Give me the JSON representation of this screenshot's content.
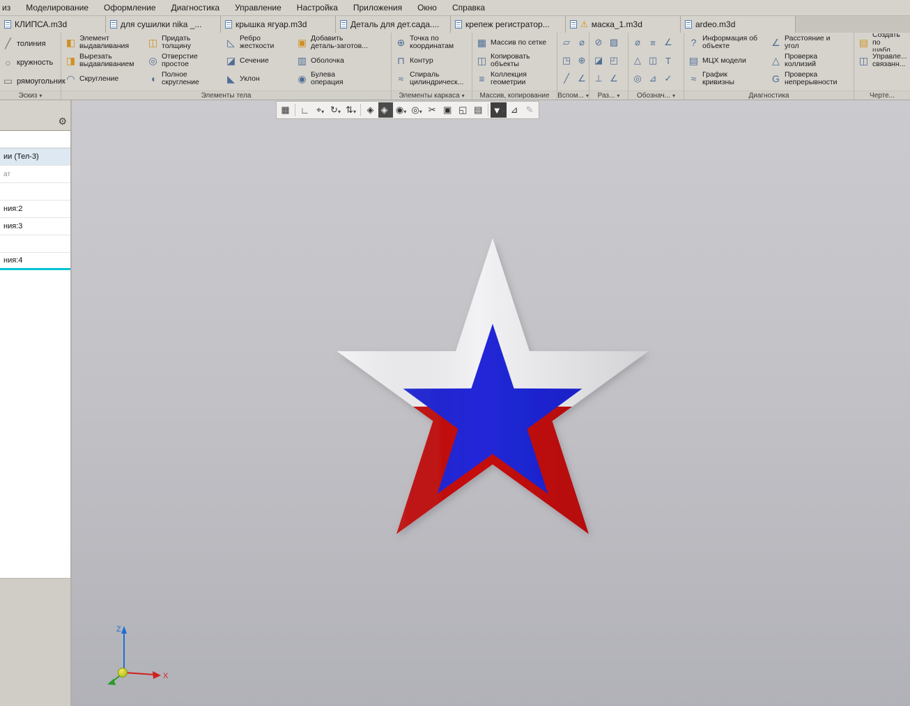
{
  "menu_bar": {
    "items": [
      "из",
      "Моделирование",
      "Оформление",
      "Диагностика",
      "Управление",
      "Настройка",
      "Приложения",
      "Окно",
      "Справка"
    ]
  },
  "tab_bar": {
    "warning_glyph": "⚠",
    "tabs": [
      {
        "label": "КЛИПСА.m3d"
      },
      {
        "label": "для сушилки nika _..."
      },
      {
        "label": "крышка ягуар.m3d"
      },
      {
        "label": "Деталь для дет.сада...."
      },
      {
        "label": "крепеж регистратор..."
      },
      {
        "label": "маска_1.m3d",
        "warning": true
      },
      {
        "label": "ardeo.m3d"
      }
    ]
  },
  "ribbon": {
    "sketch_group": {
      "label": "Эскиз",
      "tools": [
        {
          "label": "толиния",
          "glyph": "╱"
        },
        {
          "label": "кружность",
          "glyph": "○"
        },
        {
          "label": "рямоугольник",
          "glyph": "▭"
        }
      ]
    },
    "body_group": {
      "label": "Элементы тела",
      "buttons": [
        {
          "label": "Элемент\nвыдавливания",
          "glyph": "◧"
        },
        {
          "label": "Вырезать\nвыдавливанием",
          "glyph": "◨"
        },
        {
          "label": "Скругление",
          "glyph": "◠"
        },
        {
          "label": "Придать\nтолщину",
          "glyph": "◫"
        },
        {
          "label": "Отверстие\nпростое",
          "glyph": "◎"
        },
        {
          "label": "Полное\nскругление",
          "glyph": "◖"
        },
        {
          "label": "Ребро\nжесткости",
          "glyph": "◺"
        },
        {
          "label": "Сечение",
          "glyph": "◪"
        },
        {
          "label": "Уклон",
          "glyph": "◣"
        },
        {
          "label": "Добавить\nдеталь-заготов...",
          "glyph": "▣"
        },
        {
          "label": "Оболочка",
          "glyph": "▥"
        },
        {
          "label": "Булева\nоперация",
          "glyph": "◉"
        }
      ]
    },
    "frame_group": {
      "label": "Элементы каркаса",
      "buttons": [
        {
          "label": "Точка по\nкоординатам",
          "glyph": "⊕"
        },
        {
          "label": "Контур",
          "glyph": "⊓"
        },
        {
          "label": "Спираль\nцилиндрическ...",
          "glyph": "≈"
        }
      ]
    },
    "array_group": {
      "label": "Массив, копирование",
      "buttons": [
        {
          "label": "Массив по сетке",
          "glyph": "▦"
        },
        {
          "label": "Копировать\nобъекты",
          "glyph": "◫"
        },
        {
          "label": "Коллекция\nгеометрии",
          "glyph": "≡"
        }
      ]
    },
    "aux_group": {
      "label": "Вспом...",
      "icons": [
        "▱",
        "◳",
        "╱",
        "⌀",
        "⊕",
        "∠"
      ]
    },
    "sections_group": {
      "label": "Раз...",
      "icons": [
        "⊘",
        "◪",
        "⊥",
        "▨",
        "◰",
        "∠"
      ]
    },
    "notations_group": {
      "label": "Обознач...",
      "icons": [
        "⌀",
        "△",
        "◎",
        "≡",
        "◫",
        "⊿",
        "∠",
        "Т",
        "✓"
      ]
    },
    "diagnostics_group": {
      "label": "Диагностика",
      "buttons": [
        {
          "label": "Информация об\nобъекте",
          "glyph": "?"
        },
        {
          "label": "МЦХ модели",
          "glyph": "▤"
        },
        {
          "label": "График\nкривизны",
          "glyph": "≈"
        },
        {
          "label": "Расстояние и\nугол",
          "glyph": "∠"
        },
        {
          "label": "Проверка\nколлизий",
          "glyph": "△"
        },
        {
          "label": "Проверка\nнепрерывности",
          "glyph": "G"
        }
      ]
    },
    "drawing_group": {
      "label": "Черте...",
      "buttons": [
        {
          "label": "Создать\nпо шабл...",
          "glyph": "▤"
        },
        {
          "label": "Управле...\nсвязанн...",
          "glyph": "◫"
        }
      ]
    }
  },
  "left_panel": {
    "gear_glyph": "⚙",
    "rows": [
      {
        "label": "ии (Тел-3)"
      },
      {
        "label": "ат"
      },
      {
        "label": ""
      },
      {
        "label": "ния:2"
      },
      {
        "label": "ния:3"
      },
      {
        "label": ""
      },
      {
        "label": "ния:4"
      }
    ]
  },
  "viewport_toolbar": {
    "buttons": [
      {
        "name": "snap-grid",
        "glyph": "▦"
      },
      {
        "name": "coordinate-system",
        "glyph": "∟"
      },
      {
        "name": "zoom",
        "glyph": "⌖"
      },
      {
        "name": "orientation",
        "glyph": "↻"
      },
      {
        "name": "direction",
        "glyph": "⇅"
      },
      {
        "name": "isometry",
        "glyph": "◈"
      },
      {
        "name": "display-mode",
        "glyph": "◈"
      },
      {
        "name": "hide-objects",
        "glyph": "◉"
      },
      {
        "name": "hide-in-component",
        "glyph": "◎"
      },
      {
        "name": "section-view",
        "glyph": "✂"
      },
      {
        "name": "zone",
        "glyph": "▣"
      },
      {
        "name": "detail-zone",
        "glyph": "◱"
      },
      {
        "name": "report",
        "glyph": "▤"
      },
      {
        "name": "filter",
        "glyph": "▼"
      },
      {
        "name": "measure",
        "glyph": "⊿"
      },
      {
        "name": "pen",
        "glyph": "✎"
      }
    ]
  },
  "viewport": {
    "triad": {
      "x_label": "X",
      "z_label": "Z"
    },
    "star_colors": {
      "white": "#f2f2f4",
      "blue": "#2026d8",
      "red": "#c50f0f"
    }
  }
}
